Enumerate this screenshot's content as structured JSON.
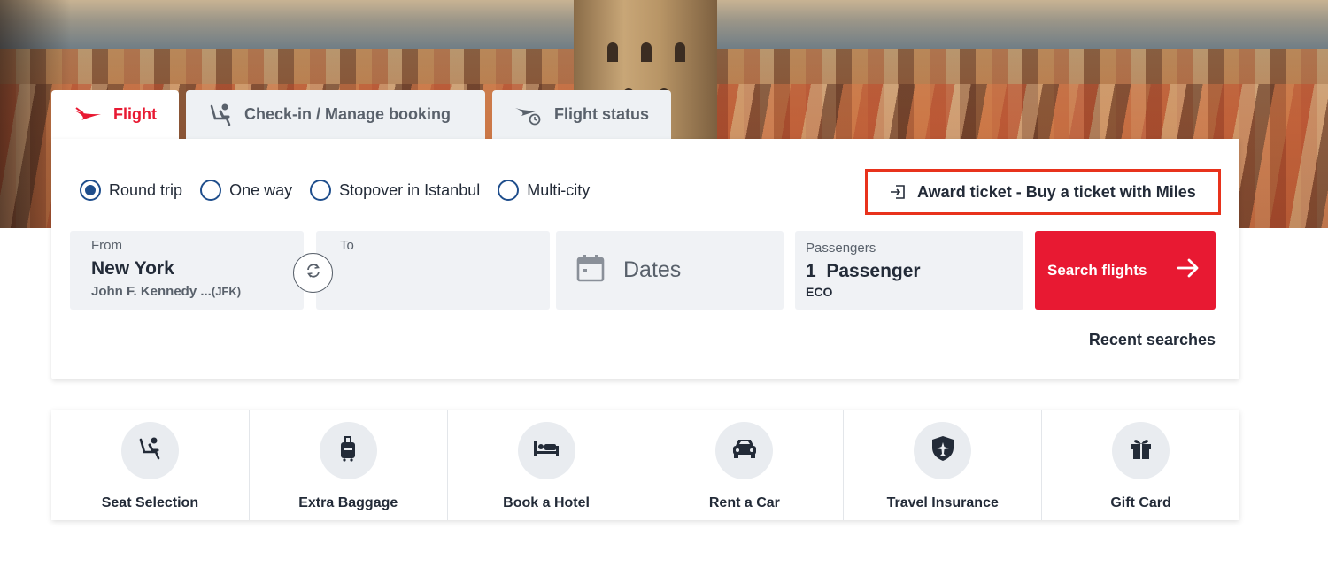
{
  "tabs": [
    {
      "label": "Flight",
      "icon": "plane-icon",
      "active": true
    },
    {
      "label": "Check-in / Manage booking",
      "icon": "seat-icon",
      "active": false
    },
    {
      "label": "Flight status",
      "icon": "flight-status-icon",
      "active": false
    }
  ],
  "trip_types": [
    {
      "label": "Round trip",
      "selected": true
    },
    {
      "label": "One way",
      "selected": false
    },
    {
      "label": "Stopover in Istanbul",
      "selected": false
    },
    {
      "label": "Multi-city",
      "selected": false
    }
  ],
  "award": {
    "label": "Award ticket - Buy a ticket with Miles",
    "icon": "sign-in-icon"
  },
  "from": {
    "label": "From",
    "city": "New York",
    "airport": "John F. Kennedy ...",
    "code": "(JFK)"
  },
  "to": {
    "label": "To",
    "value": ""
  },
  "dates": {
    "placeholder": "Dates",
    "icon": "calendar-icon"
  },
  "passengers": {
    "label": "Passengers",
    "count": "1",
    "unit": "Passenger",
    "cabin": "ECO"
  },
  "search": {
    "label": "Search flights",
    "icon": "arrow-right-icon"
  },
  "recent": {
    "label": "Recent searches"
  },
  "services": [
    {
      "label": "Seat Selection",
      "icon": "seat-icon"
    },
    {
      "label": "Extra Baggage",
      "icon": "baggage-icon"
    },
    {
      "label": "Book a Hotel",
      "icon": "bed-icon"
    },
    {
      "label": "Rent a Car",
      "icon": "car-icon"
    },
    {
      "label": "Travel Insurance",
      "icon": "shield-plane-icon"
    },
    {
      "label": "Gift Card",
      "icon": "gift-icon"
    }
  ],
  "colors": {
    "brand_red": "#e81932",
    "radio_blue": "#1f4e8c",
    "highlight_border": "#e8321c",
    "text_dark": "#232b38"
  }
}
